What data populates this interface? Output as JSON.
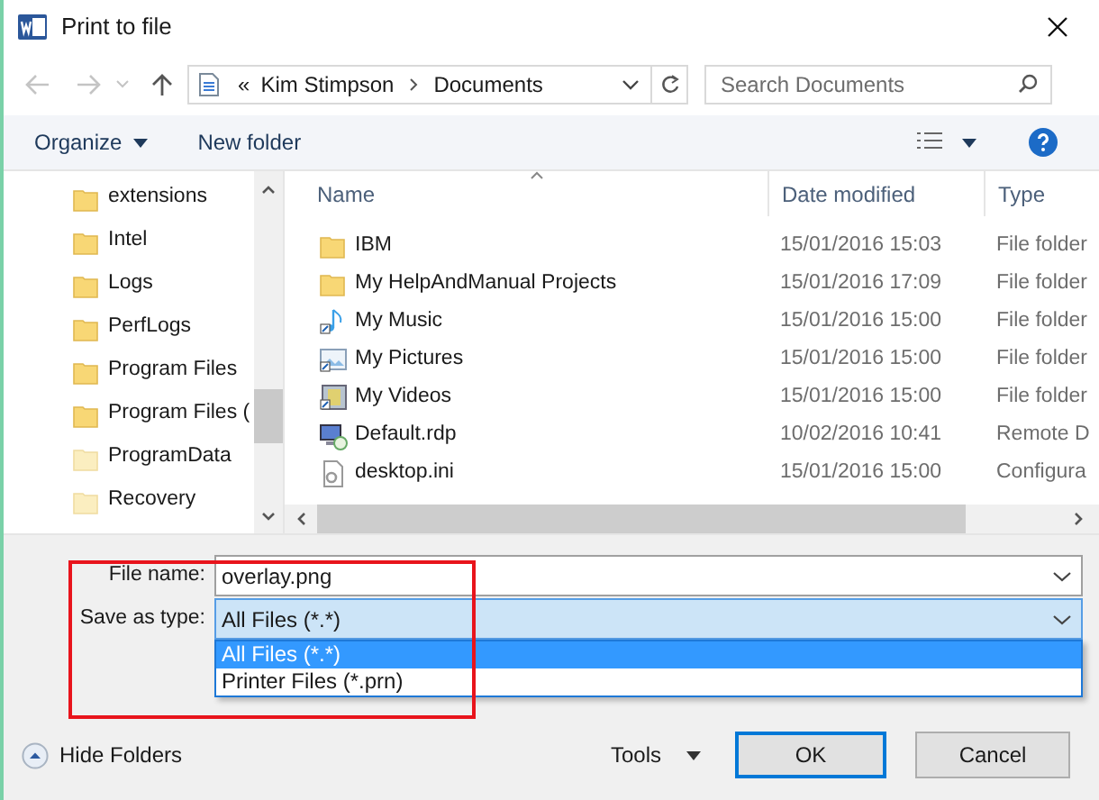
{
  "window": {
    "title": "Print to file"
  },
  "address_bar": {
    "overflow": "«",
    "path": [
      "Kim Stimpson",
      "Documents"
    ]
  },
  "search": {
    "placeholder": "Search Documents"
  },
  "toolbar": {
    "organize": "Organize",
    "new_folder": "New folder"
  },
  "nav_tree": [
    {
      "label": "extensions",
      "kind": "folder"
    },
    {
      "label": "Intel",
      "kind": "folder"
    },
    {
      "label": "Logs",
      "kind": "folder"
    },
    {
      "label": "PerfLogs",
      "kind": "folder"
    },
    {
      "label": "Program Files",
      "kind": "folder"
    },
    {
      "label": "Program Files (",
      "kind": "folder"
    },
    {
      "label": "ProgramData",
      "kind": "hidden"
    },
    {
      "label": "Recovery",
      "kind": "hidden"
    }
  ],
  "table": {
    "columns": [
      "Name",
      "Date modified",
      "Type"
    ],
    "rows": [
      {
        "name": "IBM",
        "date": "15/01/2016 15:03",
        "type": "File folder",
        "kind": "folder"
      },
      {
        "name": "My HelpAndManual Projects",
        "date": "15/01/2016 17:09",
        "type": "File folder",
        "kind": "folder"
      },
      {
        "name": "My Music",
        "date": "15/01/2016 15:00",
        "type": "File folder",
        "kind": "music"
      },
      {
        "name": "My Pictures",
        "date": "15/01/2016 15:00",
        "type": "File folder",
        "kind": "pictures"
      },
      {
        "name": "My Videos",
        "date": "15/01/2016 15:00",
        "type": "File folder",
        "kind": "videos"
      },
      {
        "name": "Default.rdp",
        "date": "10/02/2016 10:41",
        "type": "Remote D",
        "kind": "rdp"
      },
      {
        "name": "desktop.ini",
        "date": "15/01/2016 15:00",
        "type": "Configura",
        "kind": "ini"
      }
    ]
  },
  "file_name": {
    "label": "File name:",
    "value": "overlay.png"
  },
  "save_as_type": {
    "label": "Save as type:",
    "value": "All Files (*.*)",
    "options": [
      {
        "label": "All Files (*.*)",
        "selected": true
      },
      {
        "label": "Printer Files (*.prn)",
        "selected": false
      }
    ]
  },
  "footer": {
    "hide_folders": "Hide Folders",
    "tools": "Tools",
    "ok": "OK",
    "cancel": "Cancel"
  }
}
